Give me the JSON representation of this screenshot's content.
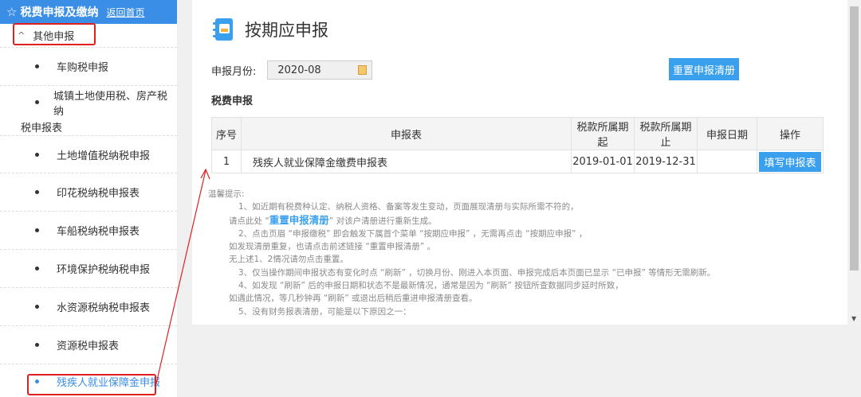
{
  "sidebar": {
    "header_title": "税费申报及缴纳",
    "header_back": "返回首页",
    "group_label": "其他申报",
    "group_caret": "^",
    "items": [
      {
        "label": "车购税申报"
      },
      {
        "label_line1": "城镇土地使用税、房产税纳",
        "label_line2": "税申报表"
      },
      {
        "label": "土地增值税纳税申报"
      },
      {
        "label": "印花税纳税申报表"
      },
      {
        "label": "车船税纳税申报表"
      },
      {
        "label": "环境保护税纳税申报"
      },
      {
        "label": "水资源税纳税申报表"
      },
      {
        "label": "资源税申报表"
      },
      {
        "label": "残疾人就业保障金申报"
      }
    ]
  },
  "main": {
    "page_title": "按期应申报",
    "month_label": "申报月份:",
    "month_value": "2020-08",
    "reset_button": "重置申报清册",
    "section_title": "税费申报",
    "table": {
      "headers": [
        "序号",
        "申报表",
        "税款所属期起",
        "税款所属期止",
        "申报日期",
        "操作"
      ],
      "rows": [
        {
          "index": "1",
          "form": "残疾人就业保障金缴费申报表",
          "start": "2019-01-01",
          "end": "2019-12-31",
          "date": "",
          "action": "填写申报表"
        }
      ]
    },
    "notes": {
      "heading": "温馨提示:",
      "n1a": "1、如近期有税费种认定、纳税人资格、备案等发生变动，页面展现清册与实际所需不符的，",
      "n1b_pre": "请点此处 “",
      "n1b_link": "重置申报清册",
      "n1b_post": "” 对该户清册进行重新生成。",
      "n2a": "2、点击页眉 “申报缴税” 即会触发下属首个菜单 “按期应申报” ，无需再点击 “按期应申报” ，",
      "n2b": "如发现清册重复，也请点击前述链接 “重置申报清册” 。",
      "n2c": "无上述1、2情况请勿点击重置。",
      "n3": "3、仅当操作期间申报状态有变化时点 “刷新” ，切换月份、刚进入本页面、申报完成后本页面已显示 “已申报” 等情形无需刷新。",
      "n4a": "4、如发现 “刷新” 后的申报日期和状态不是最新情况，通常是因为 “刷新” 按钮所查数据同步延时所致，",
      "n4b": "如遇此情况，等几秒钟再 “刷新” 或退出后稍后重进申报清册查看。",
      "n5": "5、没有财务报表清册，可能是以下原因之一："
    }
  },
  "colors": {
    "accent": "#3a8ee6",
    "button": "#3aa0ee",
    "highlight": "#e02020"
  }
}
